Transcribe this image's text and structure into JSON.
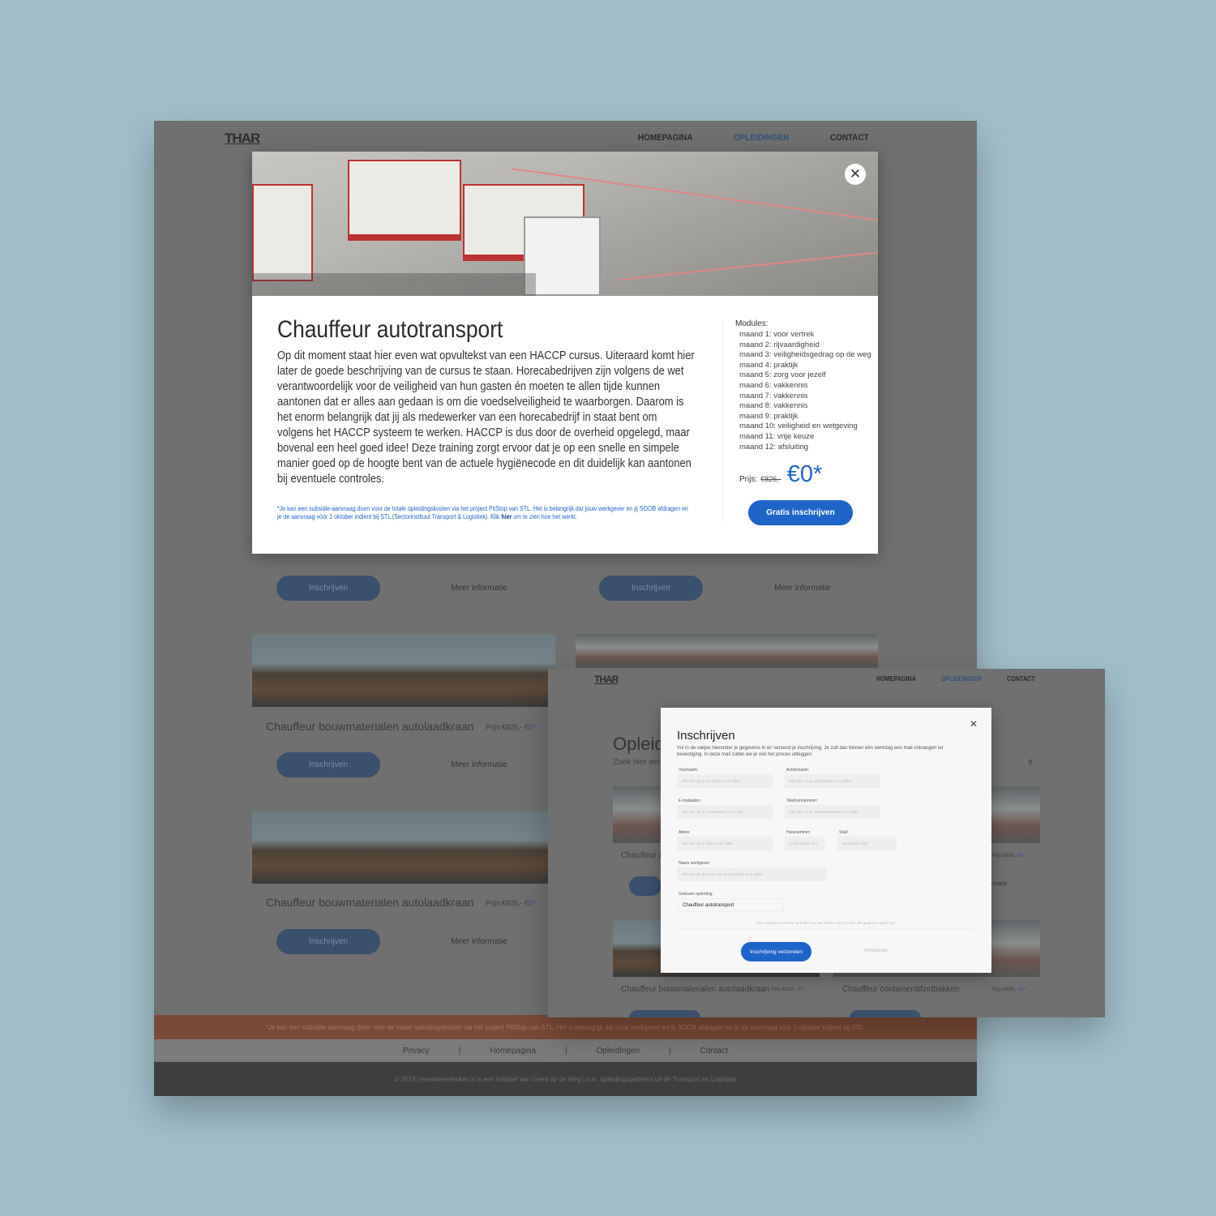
{
  "brand": "THAR",
  "nav": [
    "HOMEPAGINA",
    "OPLEIDINGEN",
    "CONTACT"
  ],
  "nav_active_color": "#34507a",
  "course_modal": {
    "title": "Chauffeur autotransport",
    "description": "Op dit moment staat hier even wat opvultekst van een HACCP cursus. Uiteraard komt hier later de goede beschrijving van de cursus te staan. Horecabedrijven zijn volgens de wet verantwoordelijk voor de veiligheid van hun gasten én moeten te allen tijde kunnen aantonen dat er alles aan gedaan is om die voedselveiligheid te waarborgen. Daarom is het enorm belangrijk dat jij als medewerker van een horecabedrijf in staat bent om volgens het HACCP systeem te werken. HACCP is dus door de overheid opgelegd, maar bovenal een heel goed idee! Deze training zorgt ervoor dat je op een snelle en simpele manier goed op de hoogte bent van de actuele hygiënecode en dit duidelijk kan aantonen bij eventuele controles.",
    "footnote_pre": "*Je kan een subsidie-aanvraag doen voor de totale opleidingskosten via het project PitStop van STL. Het is belangrijk dat jouw werkgever en jij SOOB afdragen en je de aanvraag vóór 1 oktober indient bij STL (Sectorinstituut Transport & Logistiek). Klik ",
    "footnote_link": "hier",
    "footnote_post": " om te zien hoe het werkt.",
    "modules_label": "Modules:",
    "modules": [
      "maand 1: voor vertrek",
      "maand 2: rijvaardigheid",
      "maand 3: veiligheidsgedrag op de weg",
      "maand 4: praktijk",
      "maand 5: zorg voor jezelf",
      "maand 6: vakkennis",
      "maand 7: vakkennis",
      "maand 8: vakkennis",
      "maand 9: praktijk",
      "maand 10: veiligheid en wetgeving",
      "maand 11: vrije keuze",
      "maand 12: afsluiting"
    ],
    "price_label": "Prijs:",
    "old_price": "€826,-",
    "new_price": "€0*",
    "cta": "Gratis inschrijven",
    "accent": "#1f64c8"
  },
  "cards": {
    "enroll": "Inschrijven",
    "more": "Meer informatie",
    "title_crane": "Chauffeur bouwmaterialen autolaadkraan",
    "title_container": "Chauffeur container/afzetbakken",
    "title_partial": "Chauffeur a",
    "price_label": "Prijs:€826,-",
    "price_new": "€0*",
    "more_partial": "rmatie"
  },
  "footer": {
    "notice": "*Je kan een subsidie-aanvraag doen voor de totale opleidingskosten via het project PitStop van STL. Het is belangrijk dat jouw werkgever en jij SOOB afdragen en je de aanvraag vóór 1 oktober indient bij STL.",
    "links": [
      "Privacy",
      "Homepagina",
      "Opleidingen",
      "Contact"
    ],
    "copyright": "© 2019 | maakleren­leuker.nl is een initiatief van Goed op de Weg i.s.m. opleidingspartners uit de Transport en Logistiek"
  },
  "page2": {
    "heading_partial": "Opleidi",
    "search_partial": "Zoek hier een c"
  },
  "enroll_modal": {
    "title": "Inschrijven",
    "intro": "Vul in de vakjes hieronder je gegevens in en verzend je inschrijving. Je zult dan binnen één werkdag een mail ontvangen ter bevestiging. In deze mail zullen we je ook het proces uitleggen.",
    "fields": {
      "first_name": {
        "label": "Voornaam:",
        "placeholder": "Klik hier om je voornaam in te vullen"
      },
      "last_name": {
        "label": "Achternaam:",
        "placeholder": "Klik hier om je achternaam in te vullen"
      },
      "email": {
        "label": "E-mailadres:",
        "placeholder": "Klik hier om je e-mailadres in te vullen"
      },
      "phone": {
        "label": "Telefoonnummer:",
        "placeholder": "Klik hier om je telefoonnummer in te vullen"
      },
      "address": {
        "label": "Adres:",
        "placeholder": "Klik hier om je adres in te vullen"
      },
      "house_number": {
        "label": "Huisnummer:",
        "placeholder": "Huisnummer hier"
      },
      "city": {
        "label": "Stad:",
        "placeholder": "Stadsnaam hier"
      },
      "employer": {
        "label": "Naam werkgever:",
        "placeholder": "Klik hier om de naam van je werkgever in te vullen"
      },
      "course": {
        "label": "Gekozen opleiding:",
        "value": "Chauffeur autotransport"
      }
    },
    "note": "Deze gegevens worden gebruikt voor de offerte, zorg dus dat alle gegevens goed zijn!",
    "submit": "Inschrijving verzenden",
    "cancel": "Annuleren"
  }
}
